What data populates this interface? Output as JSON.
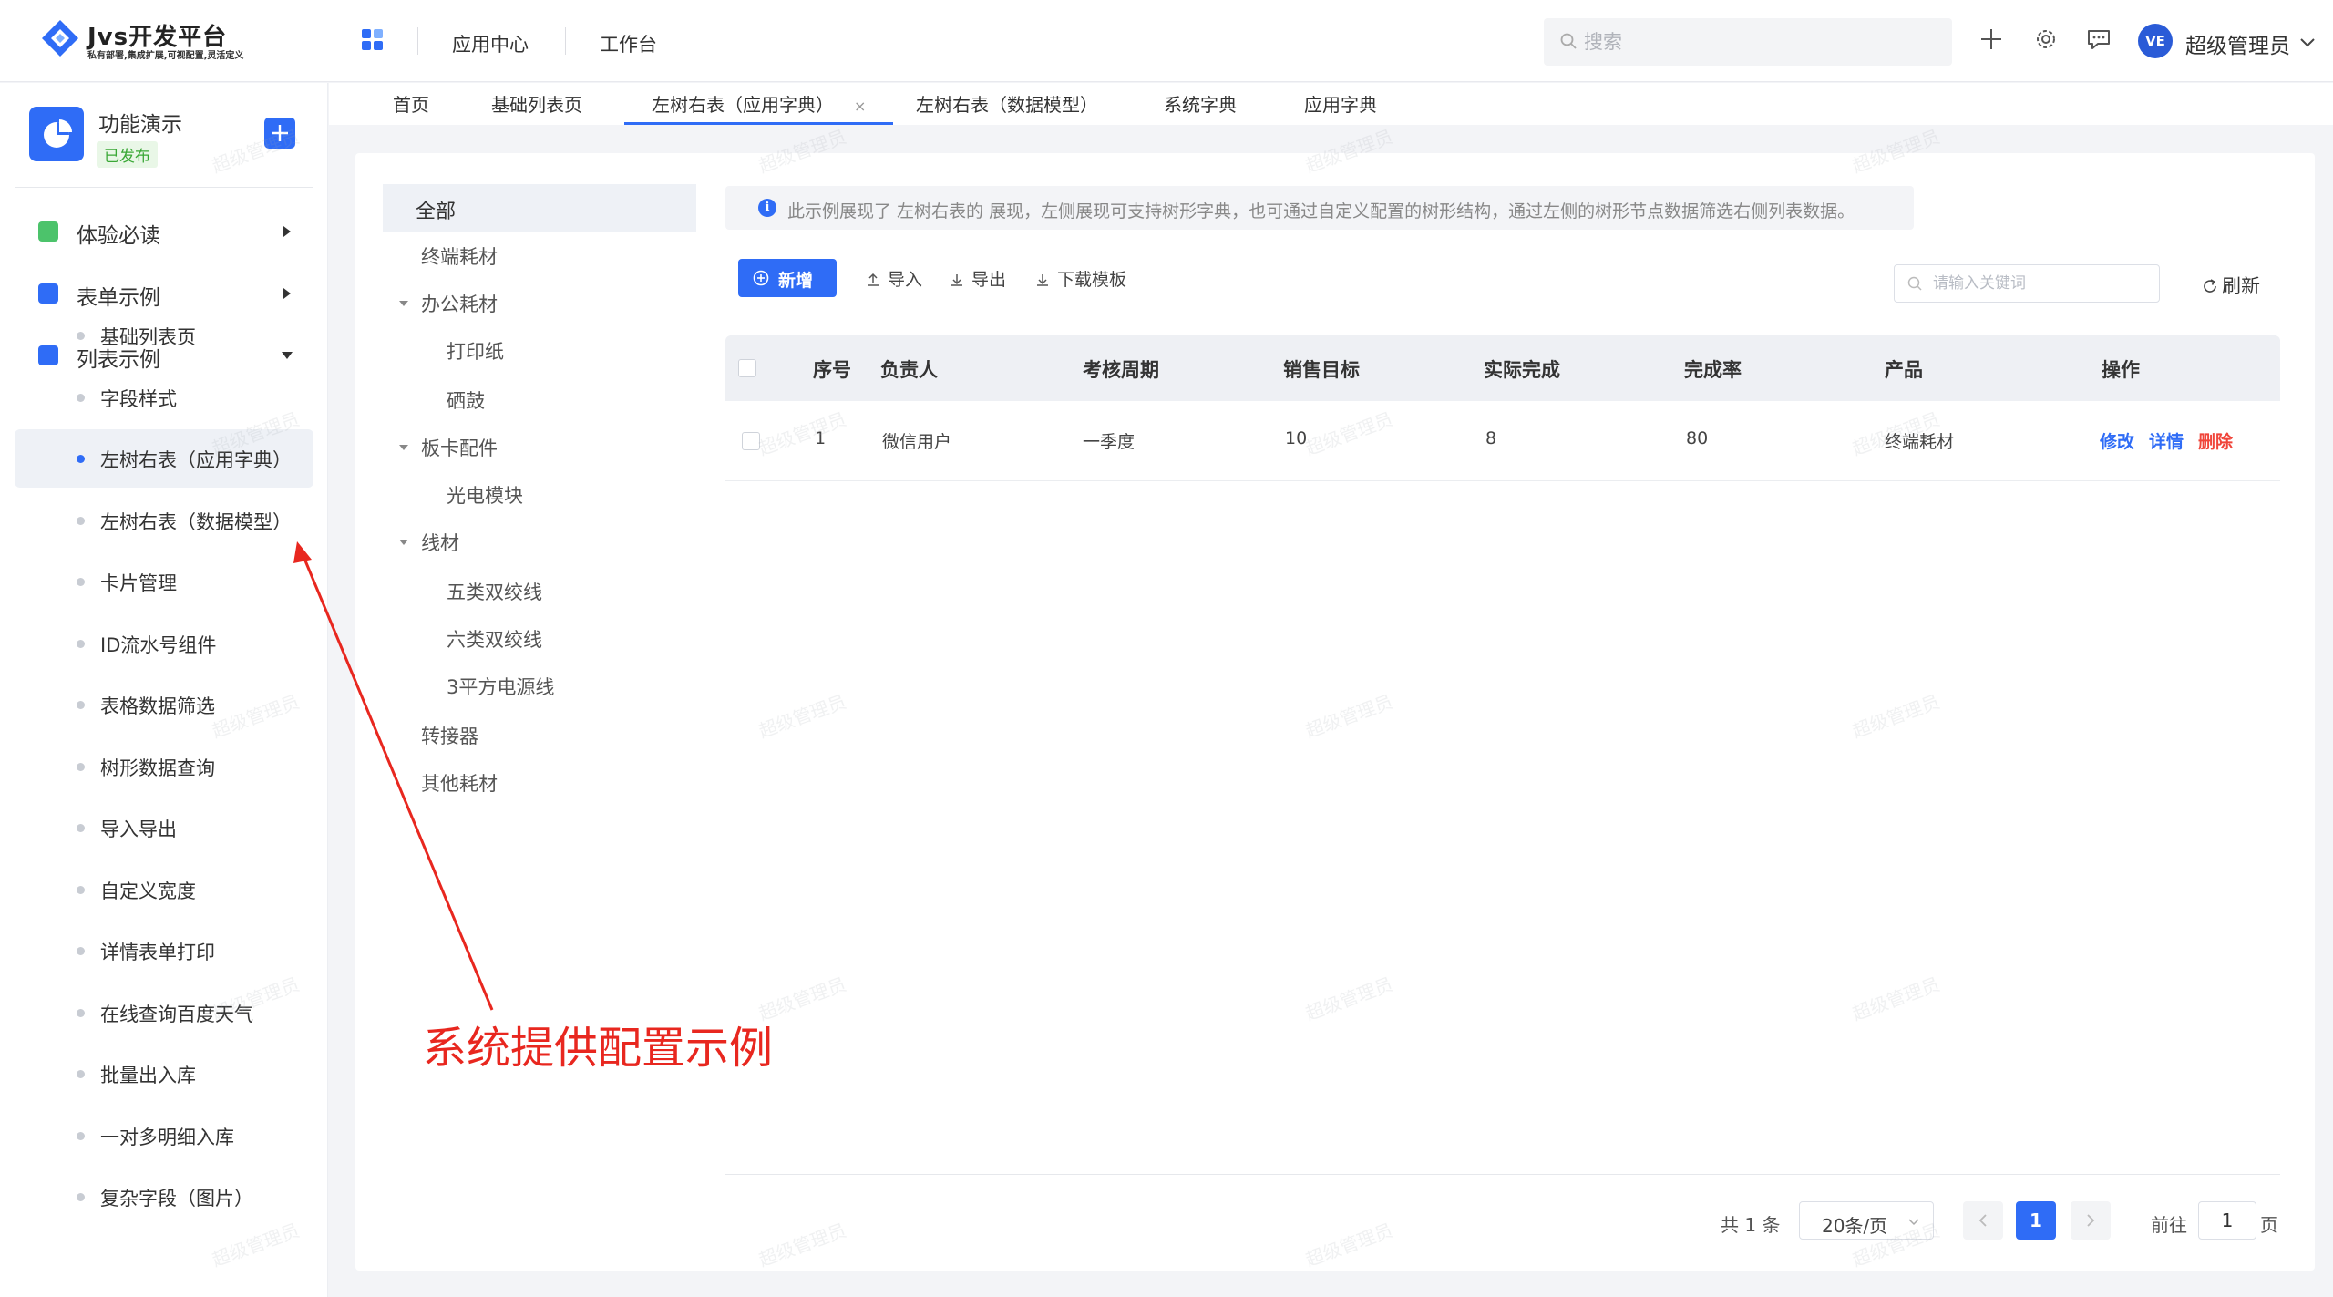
{
  "header": {
    "logo_title": "Jvs开发平台",
    "logo_subtitle": "私有部署,集成扩展,可视配置,灵活定义",
    "nav": [
      "应用中心",
      "工作台"
    ],
    "search_placeholder": "搜索",
    "user_avatar": "VE",
    "user_name": "超级管理员"
  },
  "sidebar": {
    "app_name": "功能演示",
    "app_status": "已发布",
    "groups": [
      {
        "label": "体验必读",
        "color": "#4cc36b"
      },
      {
        "label": "表单示例",
        "color": "#2f6cf6"
      },
      {
        "label": "列表示例",
        "color": "#2f6cf6"
      }
    ],
    "items": [
      "基础列表页",
      "字段样式",
      "左树右表（应用字典）",
      "左树右表（数据模型）",
      "卡片管理",
      "ID流水号组件",
      "表格数据筛选",
      "树形数据查询",
      "导入导出",
      "自定义宽度",
      "详情表单打印",
      "在线查询百度天气",
      "批量出入库",
      "一对多明细入库",
      "复杂字段（图片）"
    ],
    "active_item": "左树右表（应用字典）"
  },
  "tabs": [
    {
      "label": "首页"
    },
    {
      "label": "基础列表页"
    },
    {
      "label": "左树右表（应用字典）",
      "close": "×"
    },
    {
      "label": "左树右表（数据模型）"
    },
    {
      "label": "系统字典"
    },
    {
      "label": "应用字典"
    }
  ],
  "tree": {
    "all": "全部",
    "nodes": [
      "终端耗材",
      "办公耗材",
      "打印纸",
      "硒鼓",
      "板卡配件",
      "光电模块",
      "线材",
      "五类双绞线",
      "六类双绞线",
      "3平方电源线",
      "转接器",
      "其他耗材"
    ]
  },
  "notice": "此示例展现了 左树右表的 展现，左侧展现可支持树形字典，也可通过自定义配置的树形结构，通过左侧的树形节点数据筛选右侧列表数据。",
  "toolbar": {
    "new_label": "新增",
    "import_label": "导入",
    "export_label": "导出",
    "template_label": "下载模板",
    "keyword_placeholder": "请输入关键词",
    "refresh_label": "刷新"
  },
  "table": {
    "columns": [
      "序号",
      "负责人",
      "考核周期",
      "销售目标",
      "实际完成",
      "完成率",
      "产品",
      "操作"
    ],
    "rows": [
      {
        "index": "1",
        "owner": "微信用户",
        "period": "一季度",
        "target": "10",
        "actual": "8",
        "rate": "80",
        "product": "终端耗材"
      }
    ],
    "actions": {
      "edit": "修改",
      "detail": "详情",
      "delete": "删除"
    }
  },
  "pagination": {
    "total": "共 1 条",
    "page_size": "20条/页",
    "current": "1",
    "goto_label": "前往",
    "goto_value": "1",
    "unit": "页"
  },
  "watermark": "超级管理员",
  "annotation": "系统提供配置示例",
  "colors": {
    "primary": "#2f6cf6",
    "danger": "#f0453a",
    "annotation": "#e8271f",
    "status_green": "#3aa836"
  }
}
